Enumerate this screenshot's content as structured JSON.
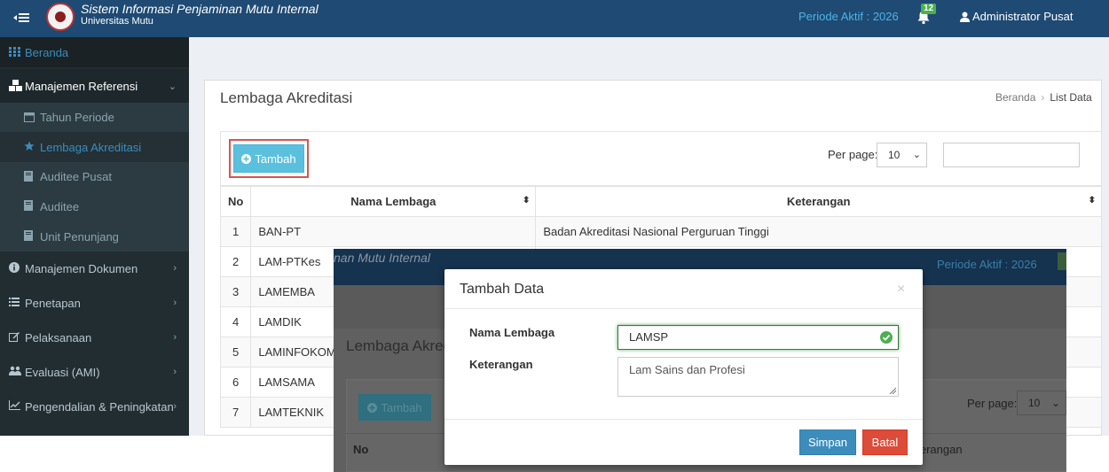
{
  "header": {
    "app_title": "Sistem Informasi Penjaminan Mutu Internal",
    "app_subtitle": "Universitas Mutu",
    "periode": "Periode Aktif : 2026",
    "notif_count": "12",
    "user": "Administrator Pusat"
  },
  "sidebar": {
    "items": [
      {
        "label": "Beranda",
        "icon": "grid-icon"
      },
      {
        "label": "Manajemen Referensi",
        "icon": "cubes-icon"
      },
      {
        "label": "Tahun Periode",
        "icon": "calendar-icon"
      },
      {
        "label": "Lembaga Akreditasi",
        "icon": "star-icon"
      },
      {
        "label": "Auditee Pusat",
        "icon": "book-icon"
      },
      {
        "label": "Auditee",
        "icon": "book-icon"
      },
      {
        "label": "Unit Penunjang",
        "icon": "book-icon"
      },
      {
        "label": "Manajemen Dokumen",
        "icon": "info-icon"
      },
      {
        "label": "Penetapan",
        "icon": "list-icon"
      },
      {
        "label": "Pelaksanaan",
        "icon": "edit-icon"
      },
      {
        "label": "Evaluasi (AMI)",
        "icon": "users-icon"
      },
      {
        "label": "Pengendalian & Peningkatan",
        "icon": "chart-icon"
      }
    ]
  },
  "main": {
    "title": "Lembaga Akreditasi",
    "breadcrumb": [
      "Beranda",
      "List Data"
    ],
    "add_button": "Tambah",
    "per_page_label": "Per page:",
    "per_page_value": "10",
    "columns": [
      "No",
      "Nama Lembaga",
      "Keterangan"
    ],
    "rows": [
      {
        "no": "1",
        "nama": "BAN-PT",
        "ket": "Badan Akreditasi Nasional Perguruan Tinggi"
      },
      {
        "no": "2",
        "nama": "LAM-PTKes",
        "ket": ""
      },
      {
        "no": "3",
        "nama": "LAMEMBA",
        "ket": ""
      },
      {
        "no": "4",
        "nama": "LAMDIK",
        "ket": ""
      },
      {
        "no": "5",
        "nama": "LAMINFOKOM",
        "ket": ""
      },
      {
        "no": "6",
        "nama": "LAMSAMA",
        "ket": ""
      },
      {
        "no": "7",
        "nama": "LAMTEKNIK",
        "ket": ""
      }
    ]
  },
  "overlay": {
    "title_fragment": "nan Mutu Internal",
    "periode": "Periode Aktif : 2026",
    "page_title_fragment": "Lembaga Akred",
    "add_button": "Tambah",
    "per_page_label": "Per page:",
    "per_page_value": "10",
    "col_no": "No",
    "col_ket_fragment": "eterangan"
  },
  "modal": {
    "title": "Tambah Data",
    "close": "×",
    "nama_label": "Nama Lembaga",
    "nama_value": "LAMSP",
    "ket_label": "Keterangan",
    "ket_value": "Lam Sains dan Profesi",
    "save": "Simpan",
    "cancel": "Batal"
  },
  "colors": {
    "topbar": "#1e4a73",
    "sidebar": "#222d32",
    "accent": "#3c8dbc",
    "info_button": "#5bc0de",
    "danger": "#dd4b39",
    "success": "#4caf50"
  }
}
